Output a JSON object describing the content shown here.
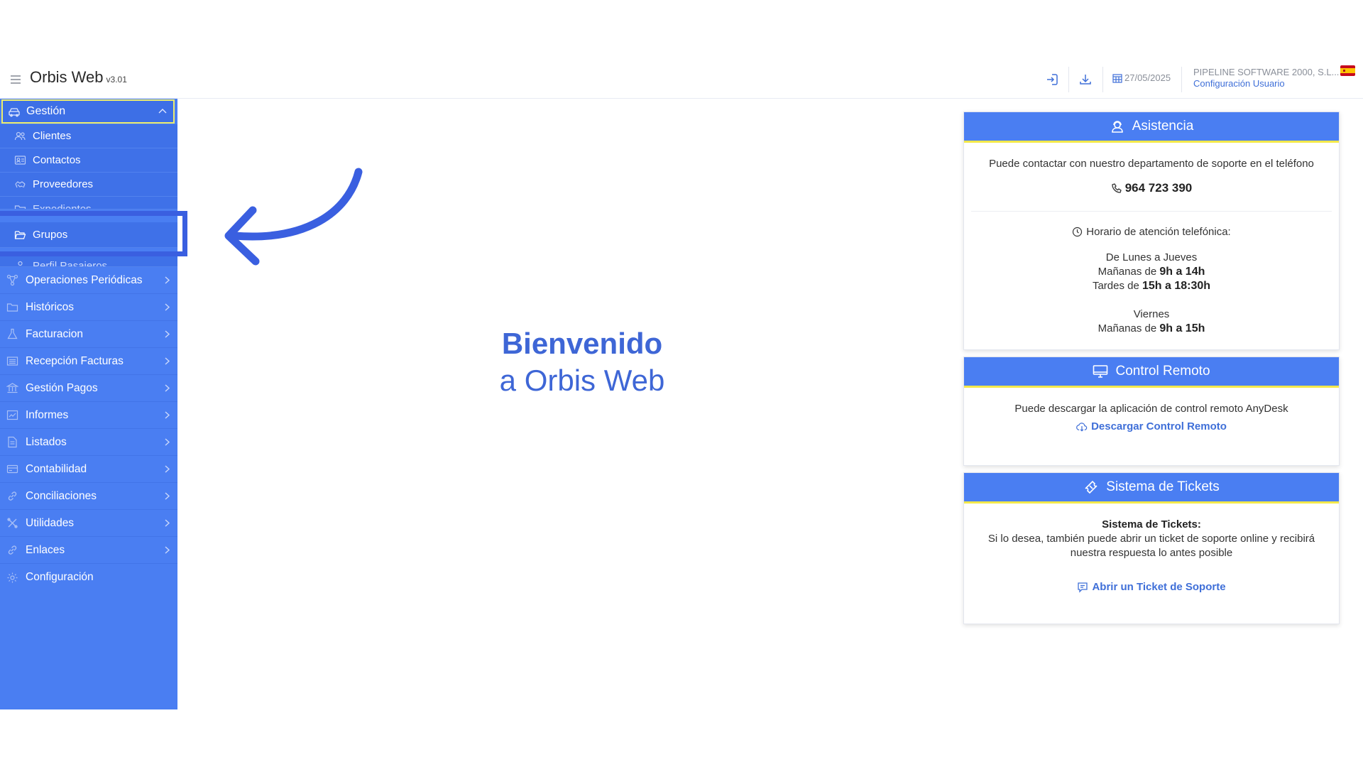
{
  "header": {
    "app_title": "Orbis Web",
    "app_version": "v3.01",
    "date": "27/05/2025",
    "company": "PIPELINE SOFTWARE 2000, S.L...",
    "config_link": "Configuración Usuario",
    "icons": [
      "login-icon",
      "download-icon",
      "calendar-icon",
      "spain-flag-icon"
    ]
  },
  "sidebar": {
    "section": {
      "label": "Gestión",
      "icon": "car-icon"
    },
    "subitems": [
      {
        "label": "Clientes",
        "icon": "users-icon"
      },
      {
        "label": "Contactos",
        "icon": "contact-card-icon"
      },
      {
        "label": "Proveedores",
        "icon": "handshake-icon"
      },
      {
        "label": "Expedientes",
        "icon": "folder-icon"
      },
      {
        "label": "Grupos",
        "icon": "folder-open-icon"
      },
      {
        "label": "Perfil Pasajeros",
        "icon": "passenger-icon"
      }
    ],
    "items": [
      {
        "label": "Operaciones Periódicas",
        "icon": "network-icon"
      },
      {
        "label": "Históricos",
        "icon": "folder-icon"
      },
      {
        "label": "Facturacion",
        "icon": "flask-icon"
      },
      {
        "label": "Recepción Facturas",
        "icon": "list-icon"
      },
      {
        "label": "Gestión Pagos",
        "icon": "bank-icon"
      },
      {
        "label": "Informes",
        "icon": "report-icon"
      },
      {
        "label": "Listados",
        "icon": "document-icon"
      },
      {
        "label": "Contabilidad",
        "icon": "ledger-icon"
      },
      {
        "label": "Conciliaciones",
        "icon": "link-icon"
      },
      {
        "label": "Utilidades",
        "icon": "tools-icon"
      },
      {
        "label": "Enlaces",
        "icon": "link-icon"
      },
      {
        "label": "Configuración",
        "icon": "gear-icon"
      }
    ]
  },
  "welcome": {
    "line1": "Bienvenido",
    "line2": "a Orbis Web"
  },
  "asistencia": {
    "title": "Asistencia",
    "intro": "Puede contactar con nuestro departamento de soporte en el teléfono",
    "phone": "964 723 390",
    "schedule_title": "Horario de atención telefónica:",
    "days1": "De Lunes a Jueves",
    "morning_label": "Mañanas de",
    "morning1": "9h a 14h",
    "afternoon_label": "Tardes de",
    "afternoon1": "15h a 18:30h",
    "days2": "Viernes",
    "morning2": "9h a 15h"
  },
  "remoto": {
    "title": "Control Remoto",
    "text": "Puede descargar la aplicación de control remoto AnyDesk",
    "link": "Descargar Control Remoto"
  },
  "tickets": {
    "title": "Sistema de Tickets",
    "subtitle": "Sistema de Tickets:",
    "text": "Si lo desea, también puede abrir un ticket de soporte online y recibirá nuestra respuesta lo antes posible",
    "link": "Abrir un Ticket de Soporte"
  },
  "colors": {
    "accent": "#4a7ef2",
    "card_stripe": "#f3e84a",
    "link": "#3f6fd8",
    "highlight": "#3a5fe0"
  }
}
